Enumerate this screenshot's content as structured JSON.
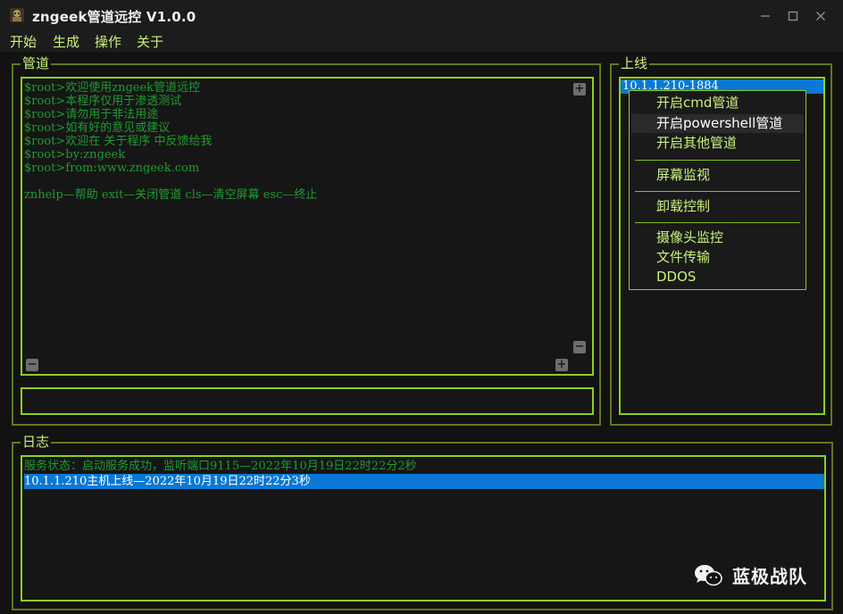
{
  "window": {
    "title": "zngeek管道远控 V1.0.0"
  },
  "menu": {
    "items": [
      "开始",
      "生成",
      "操作",
      "关于"
    ]
  },
  "pipe_panel": {
    "legend": "管道",
    "lines": [
      "$root>欢迎使用zngeek管道远控",
      "$root>本程序仅用于渗透测试",
      "$root>请勿用于非法用途",
      "$root>如有好的意见或建议",
      "$root>欢迎在 关于程序 中反馈给我",
      "$root>by:zngeek",
      "$root>from:www.zngeek.com",
      "",
      "znhelp—帮助 exit—关闭管道 cls—清空屏幕 esc—终止"
    ],
    "command_input_value": ""
  },
  "online_panel": {
    "legend": "上线",
    "hosts": [
      "10.1.1.210-1884"
    ]
  },
  "context_menu": {
    "items": [
      "开启cmd管道",
      "开启powershell管道",
      "开启其他管道",
      "屏幕监视",
      "卸载控制",
      "摄像头监控",
      "文件传输",
      "DDOS"
    ],
    "highlighted": "开启powershell管道"
  },
  "log_panel": {
    "legend": "日志",
    "lines": [
      "服务状态：启动服务成功，监听端口9115—2022年10月19日22时22分2秒",
      "10.1.1.210主机上线—2022年10月19日22时22分3秒"
    ],
    "selected_index": 1
  },
  "watermark": {
    "text": "蓝极战队"
  },
  "colors": {
    "accent": "#8bd11c",
    "console_text": "#1c9d30",
    "selection": "#0a78d4"
  }
}
